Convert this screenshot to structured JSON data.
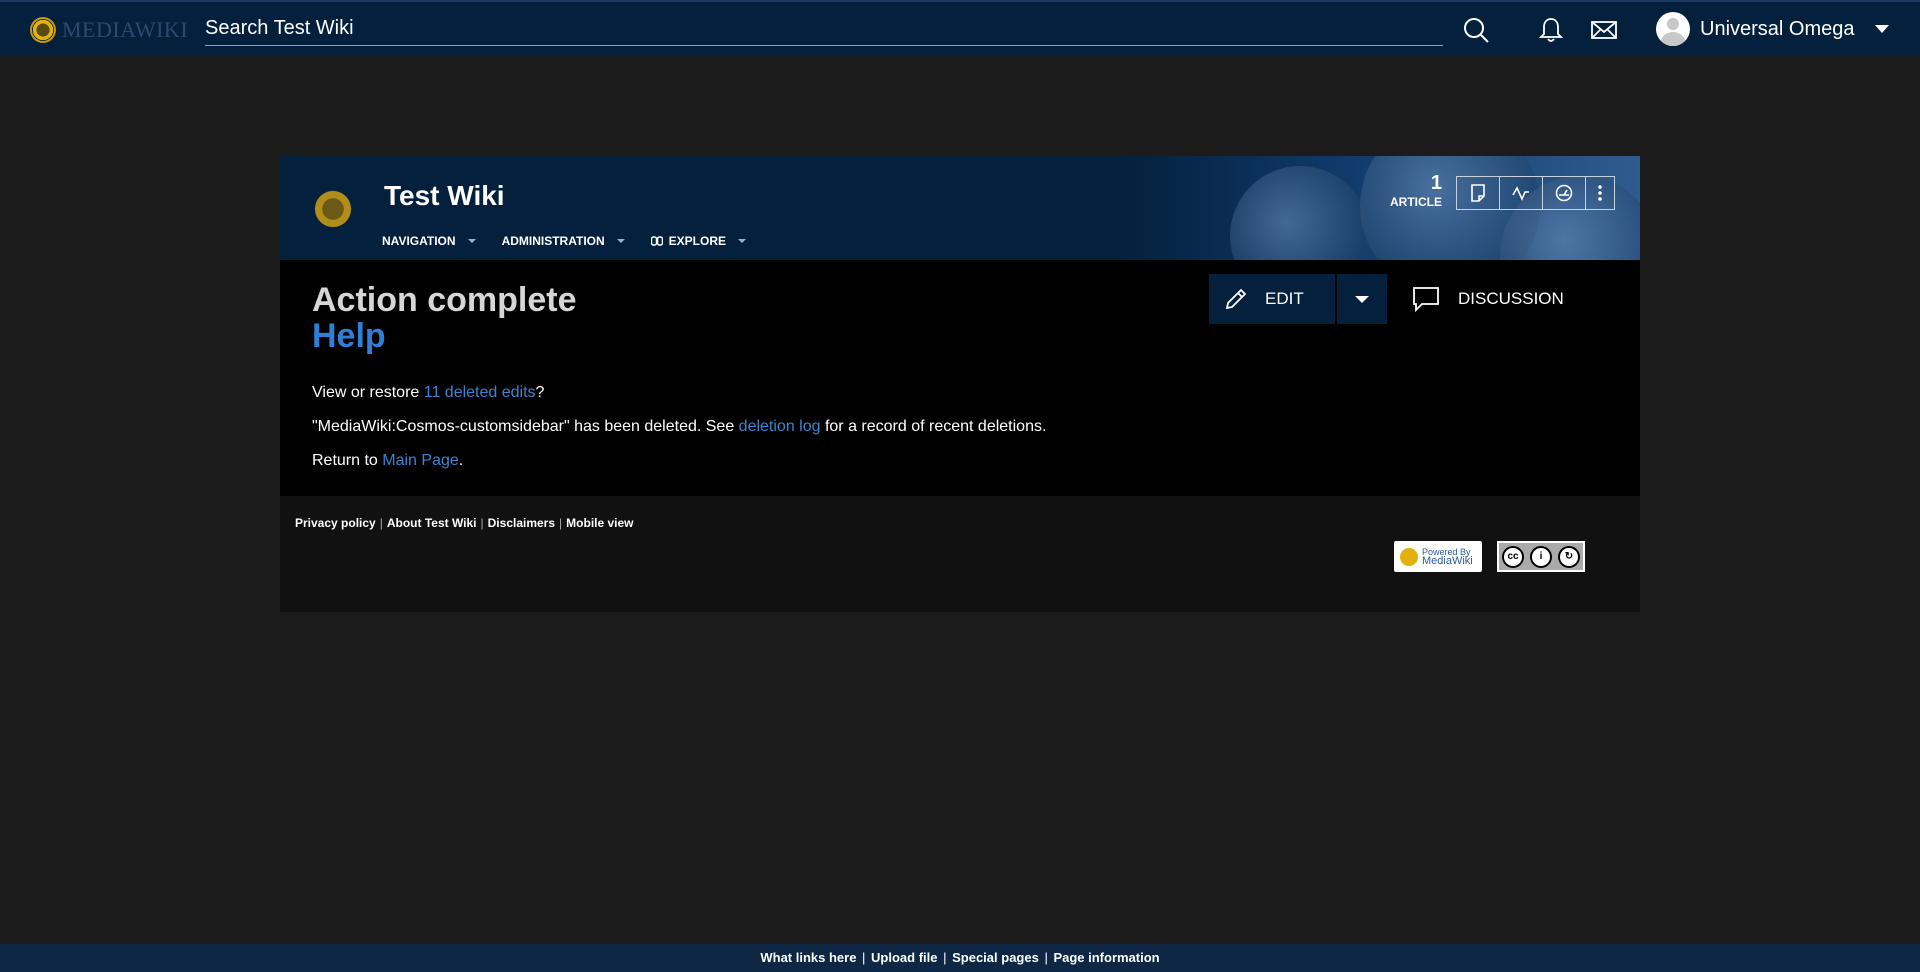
{
  "topbar": {
    "logo_text": "MEDIAWIKI",
    "search_placeholder": "Search Test Wiki",
    "user_name": "Universal Omega"
  },
  "wiki": {
    "title": "Test Wiki",
    "nav": [
      "NAVIGATION",
      "ADMINISTRATION",
      "EXPLORE"
    ],
    "article_count": "1",
    "article_label": "ARTICLE"
  },
  "page": {
    "title": "Action complete",
    "subtitle": "Help",
    "edit_label": "EDIT",
    "discussion_label": "DISCUSSION",
    "line1": {
      "prefix": "View or restore ",
      "link": "11 deleted edits",
      "suffix": "?"
    },
    "line2": {
      "prefix": "\"MediaWiki:Cosmos-customsidebar\" has been deleted. See ",
      "link": "deletion log",
      "suffix": " for a record of recent deletions."
    },
    "line3": {
      "prefix": "Return to ",
      "link": "Main Page",
      "suffix": "."
    }
  },
  "footer": {
    "links": [
      "Privacy policy",
      "About Test Wiki",
      "Disclaimers",
      "Mobile view"
    ],
    "badge_mw_top": "Powered By",
    "badge_mw_bottom": "MediaWiki",
    "badge_cc_labels": [
      "BY",
      "SA"
    ]
  },
  "bottombar": {
    "links": [
      "What links here",
      "Upload file",
      "Special pages",
      "Page information"
    ]
  },
  "colors": {
    "topbar_bg": "#04203d",
    "page_bg": "#1b1b1b",
    "content_bg": "#000000",
    "link": "#3a84d0",
    "help_title": "#2f7fd6"
  }
}
